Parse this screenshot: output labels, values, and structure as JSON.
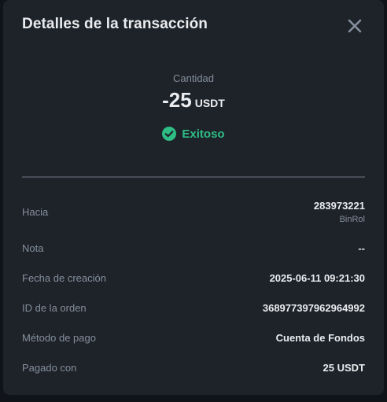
{
  "modal": {
    "title": "Detalles de la transacción"
  },
  "amount": {
    "label": "Cantidad",
    "value": "-25",
    "unit": "USDT"
  },
  "status": {
    "text": "Exitoso",
    "color": "#2ebd85"
  },
  "details": [
    {
      "label": "Hacia",
      "value": "283973221",
      "sub": "BinRol"
    },
    {
      "label": "Nota",
      "value": "--"
    },
    {
      "label": "Fecha de creación",
      "value": "2025-06-11 09:21:30"
    },
    {
      "label": "ID de la orden",
      "value": "368977397962964992"
    },
    {
      "label": "Método de pago",
      "value": "Cuenta de Fondos"
    },
    {
      "label": "Pagado con",
      "value": "25 USDT"
    }
  ],
  "icons": {
    "close": "close-icon",
    "status": "check-circle-icon"
  }
}
